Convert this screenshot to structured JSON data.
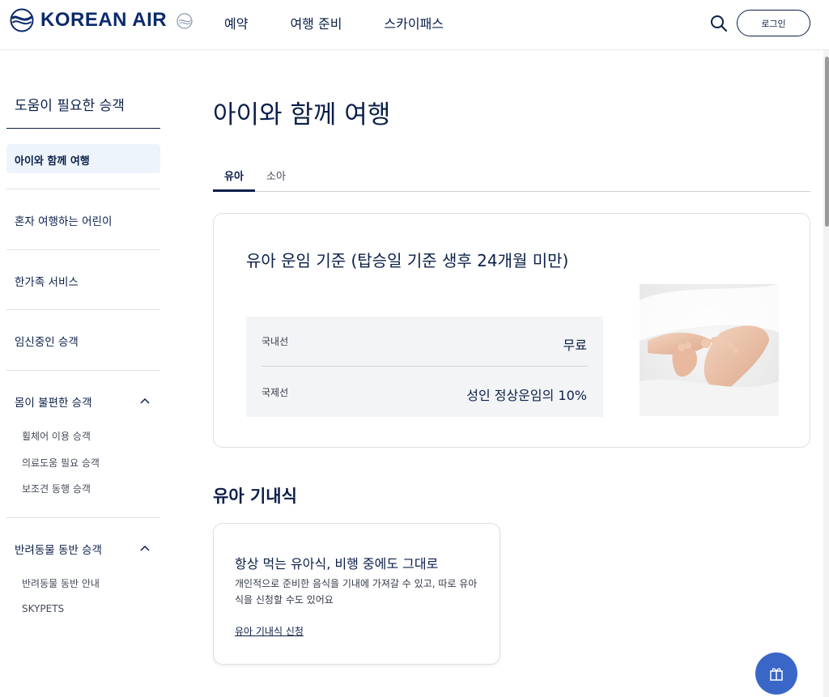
{
  "header": {
    "brand": "KOREAN AIR",
    "nav": [
      "예약",
      "여행 준비",
      "스카이패스"
    ],
    "login_label": "로그인"
  },
  "sidebar": {
    "title": "도움이 필요한 승객",
    "active_item": "아이와 함께 여행",
    "items": [
      {
        "label": "혼자 여행하는 어린이"
      },
      {
        "label": "한가족 서비스"
      },
      {
        "label": "임신중인 승객"
      },
      {
        "label": "몸이 불편한 승객",
        "expanded": true,
        "children": [
          "휠체어 이용 승객",
          "의료도움 필요 승객",
          "보조견 동행 승객"
        ]
      },
      {
        "label": "반려동물 동반 승객",
        "expanded": true,
        "children": [
          "반려동물 동반 안내",
          "SKYPETS"
        ]
      }
    ]
  },
  "main": {
    "title": "아이와 함께 여행",
    "tabs": [
      {
        "label": "유아",
        "active": true
      },
      {
        "label": "소아",
        "active": false
      }
    ],
    "fare_card": {
      "title": "유아 운임 기준 (탑승일 기준 생후 24개월 미만)",
      "rows": [
        {
          "label": "국내선",
          "value": "무료"
        },
        {
          "label": "국제선",
          "value": "성인 정상운임의 10%"
        }
      ]
    },
    "meal_section": {
      "heading": "유아 기내식",
      "card_title": "항상 먹는 유아식, 비행 중에도 그대로",
      "card_desc": "개인적으로 준비한 음식을 기내에 가져갈 수 있고, 따로 유아식을 신청할 수도 있어요",
      "link": "유아 기내식 신청"
    }
  },
  "colors": {
    "primary": "#0b1f4a",
    "accent": "#3a67c7",
    "active_bg": "#eef4fb"
  },
  "icons": {
    "search": "search-icon",
    "chevron": "chevron-up-icon",
    "fab": "gift-icon"
  }
}
